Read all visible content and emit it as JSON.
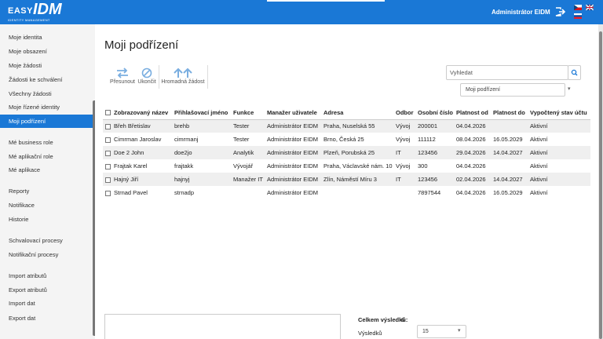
{
  "brand": {
    "logo_top": "EASY",
    "logo_main": "IDM",
    "logo_sub": "IDENTITY MANAGEMENT"
  },
  "header": {
    "user": "Administrátor EIDM"
  },
  "sidebar": {
    "items": [
      {
        "label": "Moje identita"
      },
      {
        "label": "Moje obsazení"
      },
      {
        "label": "Moje žádosti"
      },
      {
        "label": "Žádosti ke schválení"
      },
      {
        "label": "Všechny žádosti"
      },
      {
        "label": "Moje řízené identity"
      },
      {
        "label": "Moji podřízení",
        "active": true
      },
      {
        "label": "Mé business role"
      },
      {
        "label": "Mé aplikační role"
      },
      {
        "label": "Mé aplikace"
      },
      {
        "label": "Reporty"
      },
      {
        "label": "Notifikace"
      },
      {
        "label": "Historie"
      },
      {
        "label": "Schvalovací procesy"
      },
      {
        "label": "Notifikační procesy"
      },
      {
        "label": "Import atributů"
      },
      {
        "label": "Export atributů"
      },
      {
        "label": "Import dat"
      },
      {
        "label": "Export dat"
      }
    ]
  },
  "main": {
    "title": "Moji podřízení",
    "toolbar": {
      "move": "Přesunout",
      "end": "Ukončit",
      "bulk": "Hromadná žádost"
    },
    "search": {
      "placeholder": "Vyhledat"
    },
    "filter": {
      "selected": "Moji podřízení"
    },
    "table": {
      "columns": [
        "Zobrazovaný název",
        "Přihlašovací jméno",
        "Funkce",
        "Manažer uživatele",
        "Adresa",
        "Odbor",
        "Osobní číslo",
        "Platnost od",
        "Platnost do",
        "Vypočtený stav účtu"
      ],
      "rows": [
        [
          "Břeh Břetislav",
          "brehb",
          "Tester",
          "Administrátor EIDM",
          "Praha, Nuselská 55",
          "Vývoj",
          "200001",
          "04.04.2026",
          "",
          "Aktivní"
        ],
        [
          "Cimrman Jaroslav",
          "cimrmanj",
          "Tester",
          "Administrátor EIDM",
          "Brno, Česká 25",
          "Vývoj",
          "111112",
          "08.04.2026",
          "16.05.2029",
          "Aktivní"
        ],
        [
          "Doe 2 John",
          "doe2jo",
          "Analytik",
          "Administrátor EIDM",
          "Plzeň, Porubská 25",
          "IT",
          "123456",
          "29.04.2026",
          "14.04.2027",
          "Aktivní"
        ],
        [
          "Frajtak Karel",
          "frajtakk",
          "Vývojář",
          "Administrátor EIDM",
          "Praha, Václavské nám. 10",
          "Vývoj",
          "300",
          "04.04.2026",
          "",
          "Aktivní"
        ],
        [
          "Hajný Jiří",
          "hajnyj",
          "Manažer IT",
          "Administrátor EIDM",
          "Zlín, Náměstí Míru 3",
          "IT",
          "123456",
          "02.04.2026",
          "14.04.2027",
          "Aktivní"
        ],
        [
          "Strnad Pavel",
          "strnadp",
          "",
          "Administrátor EIDM",
          "",
          "",
          "7897544",
          "04.04.2026",
          "16.05.2029",
          "Aktivní"
        ]
      ]
    },
    "footer": {
      "total_label": "Celkem výsledků:",
      "total_count": "6",
      "per_page_label": "Výsledků na stránku",
      "per_page": "15"
    }
  }
}
